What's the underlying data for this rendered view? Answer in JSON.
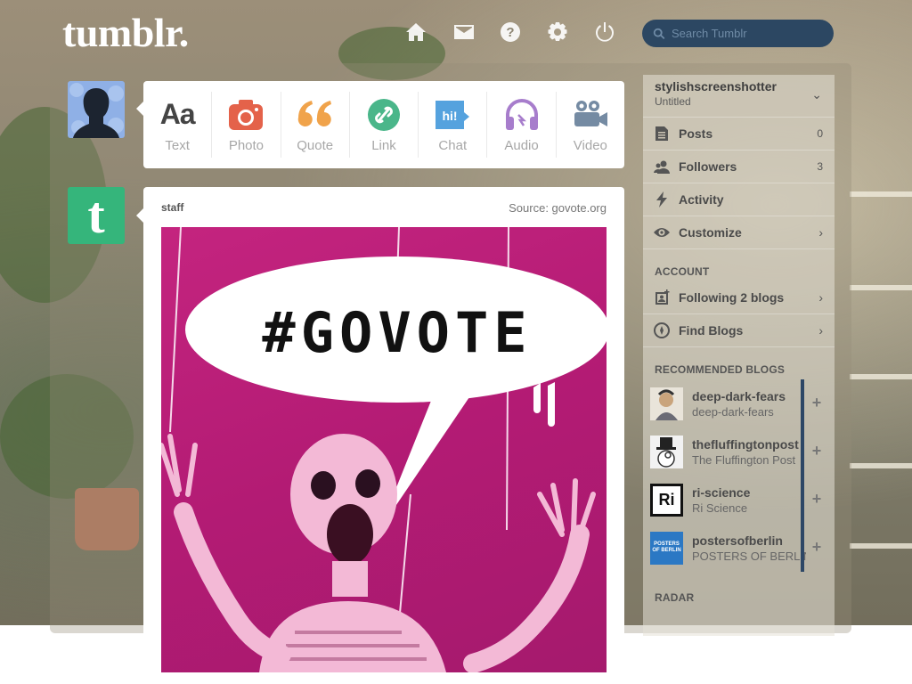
{
  "header": {
    "logo": "tumblr.",
    "search_placeholder": "Search Tumblr"
  },
  "nav_icons": [
    "home-icon",
    "mail-icon",
    "help-icon",
    "settings-icon",
    "power-icon"
  ],
  "post_types": [
    {
      "label": "Text",
      "icon": "text-icon",
      "glyph": "Aa",
      "color": "#444444"
    },
    {
      "label": "Photo",
      "icon": "camera-icon",
      "color": "#e4624a"
    },
    {
      "label": "Quote",
      "icon": "quote-icon",
      "glyph": "““",
      "color": "#f0a34b"
    },
    {
      "label": "Link",
      "icon": "link-icon",
      "color": "#4ab68a"
    },
    {
      "label": "Chat",
      "icon": "chat-icon",
      "glyph": "hi!",
      "color": "#55a2de"
    },
    {
      "label": "Audio",
      "icon": "headphones-icon",
      "color": "#a77dcc"
    },
    {
      "label": "Video",
      "icon": "video-camera-icon",
      "color": "#758ba3"
    }
  ],
  "post": {
    "author": "staff",
    "source": "Source: govote.org",
    "image_text": "#GOVOTE"
  },
  "sidebar": {
    "blog_name": "stylishscreenshotter",
    "blog_title": "Untitled",
    "items": [
      {
        "label": "Posts",
        "count": "0",
        "icon": "posts-icon"
      },
      {
        "label": "Followers",
        "count": "3",
        "icon": "followers-icon"
      },
      {
        "label": "Activity",
        "icon": "lightning-icon"
      },
      {
        "label": "Customize",
        "icon": "eye-icon",
        "arrow": "›"
      }
    ],
    "account_heading": "ACCOUNT",
    "account_items": [
      {
        "label": "Following 2 blogs",
        "icon": "following-icon",
        "arrow": "›"
      },
      {
        "label": "Find Blogs",
        "icon": "compass-icon",
        "arrow": "›"
      }
    ],
    "recommended_heading": "RECOMMENDED BLOGS",
    "recommended": [
      {
        "name": "deep-dark-fears",
        "subtitle": "deep-dark-fears"
      },
      {
        "name": "thefluffingtonpost",
        "subtitle": "The Fluffington Post"
      },
      {
        "name": "ri-science",
        "subtitle": "Ri Science",
        "thumb_text": "Ri"
      },
      {
        "name": "postersofberlin",
        "subtitle": "POSTERS OF BERLIN",
        "thumb_text": "POSTERS OF BERLIN"
      }
    ],
    "radar_heading": "RADAR"
  }
}
